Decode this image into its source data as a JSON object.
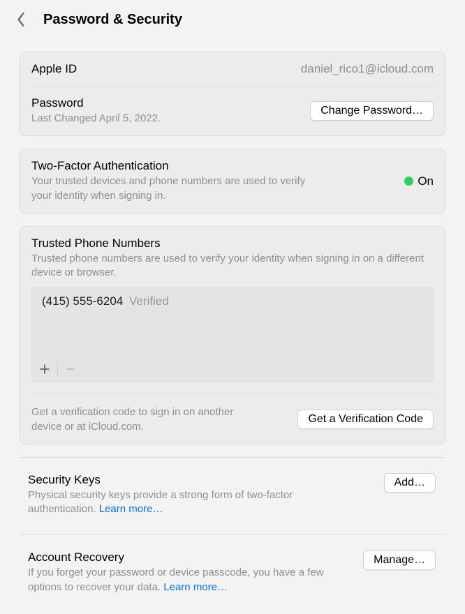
{
  "header": {
    "title": "Password & Security"
  },
  "appleid": {
    "label": "Apple ID",
    "value": "daniel_rico1@icloud.com"
  },
  "password": {
    "label": "Password",
    "sub": "Last Changed April 5, 2022.",
    "button": "Change Password…"
  },
  "tfa": {
    "label": "Two-Factor Authentication",
    "status_text": "On",
    "sub": "Your trusted devices and phone numbers are used to verify your identity when signing in."
  },
  "trusted": {
    "title": "Trusted Phone Numbers",
    "desc": "Trusted phone numbers are used to verify your identity when signing in on a different device or browser.",
    "numbers": [
      {
        "value": "(415) 555-6204",
        "status": "Verified"
      }
    ],
    "add_icon": "plus",
    "remove_icon": "minus",
    "verify_desc": "Get a verification code to sign in on another device or at iCloud.com.",
    "verify_button": "Get a Verification Code"
  },
  "security_keys": {
    "title": "Security Keys",
    "desc_prefix": "Physical security keys provide a strong form of two-factor authentication. ",
    "learn_more": "Learn more…",
    "button": "Add…"
  },
  "recovery": {
    "title": "Account Recovery",
    "desc_prefix": "If you forget your password or device passcode, you have a few options to recover your data. ",
    "learn_more": "Learn more…",
    "button": "Manage…"
  },
  "colors": {
    "status_green": "#30d158",
    "link": "#0071e3"
  }
}
